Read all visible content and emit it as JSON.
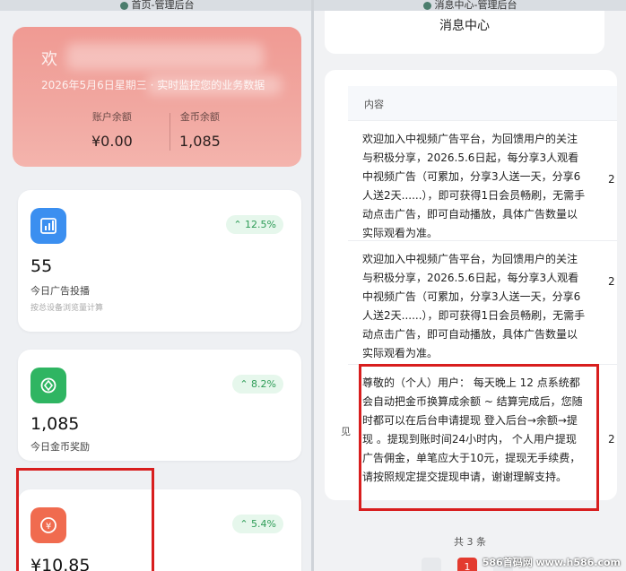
{
  "left_panel": {
    "window_title": "首页-管理后台",
    "hero": {
      "greeting": "欢",
      "date_line": "2026年5月6日星期三 · 实时监控您的业务数据",
      "stats": [
        {
          "label": "账户余额",
          "value": "¥0.00"
        },
        {
          "label": "金币余额",
          "value": "1,085"
        }
      ]
    },
    "cards": [
      {
        "icon": "bar-chart-icon",
        "icon_color": "#3b8ff0",
        "change": "12.5%",
        "value": "55",
        "caption": "今日广告投播",
        "sub": "按总设备浏览量计算"
      },
      {
        "icon": "coin-target-icon",
        "icon_color": "#2fb562",
        "change": "8.2%",
        "value": "1,085",
        "caption": "今日金币奖励"
      },
      {
        "icon": "yuan-icon",
        "icon_color": "#f06b4f",
        "change": "5.4%",
        "value": "¥10.85"
      }
    ]
  },
  "right_panel": {
    "window_title": "消息中心-管理后台",
    "header": "消息中心",
    "table": {
      "column": "内容",
      "rows": [
        {
          "content": "欢迎加入中视频广告平台，为回馈用户的关注与积极分享，2026.5.6日起，每分享3人观看中视频广告（可累加，分享3人送一天，分享6人送2天......），即可获得1日会员畅刷，无需手动点击广告，即可自动播放，具体广告数量以实际观看为准。",
          "num": "2"
        },
        {
          "content": "欢迎加入中视频广告平台，为回馈用户的关注与积极分享，2026.5.6日起，每分享3人观看中视频广告（可累加，分享3人送一天，分享6人送2天......），即可获得1日会员畅刷，无需手动点击广告，即可自动播放，具体广告数量以实际观看为准。",
          "num": "2"
        },
        {
          "content": "尊敬的（个人）用户：  每天晚上 12 点系统都会自动把金币换算成余额 ~ 结算完成后，您随时都可以在后台申请提现  登入后台→余额→提现 。提现到账时间24小时内， 个人用户提现广告佣金，单笔应大于10元，提现无手续费，请按照规定提交提现申请，谢谢理解支持。",
          "num": "2",
          "edge": "见"
        }
      ]
    },
    "total": "共 3 条",
    "current_page": "1"
  },
  "watermark": "586首码网 www.h586.com",
  "colors": {
    "highlight": "#d81e1e",
    "positive": "#2e9c57",
    "hero": "#f09a93"
  }
}
